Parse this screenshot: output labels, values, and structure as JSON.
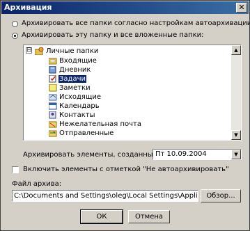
{
  "window": {
    "title": "Архивация",
    "close_glyph": "✕"
  },
  "options": {
    "radio_default": "Архивировать все папки согласно настройкам автоархивации",
    "radio_custom": "Архивировать эту папку и все вложенные папки:",
    "selected": "custom"
  },
  "tree": {
    "root": {
      "label": "Личные папки",
      "expander": "⊟",
      "icon": "personal-folders-icon"
    },
    "items": [
      {
        "label": "Входящие",
        "icon": "inbox-icon",
        "selected": false
      },
      {
        "label": "Дневник",
        "icon": "journal-icon",
        "selected": false
      },
      {
        "label": "Задачи",
        "icon": "tasks-icon",
        "selected": true
      },
      {
        "label": "Заметки",
        "icon": "notes-icon",
        "selected": false
      },
      {
        "label": "Исходящие",
        "icon": "outbox-icon",
        "selected": false
      },
      {
        "label": "Календарь",
        "icon": "calendar-icon",
        "selected": false
      },
      {
        "label": "Контакты",
        "icon": "contacts-icon",
        "selected": false
      },
      {
        "label": "Нежелательная почта",
        "icon": "junk-mail-icon",
        "selected": false
      },
      {
        "label": "Отправленные",
        "icon": "sent-items-icon",
        "selected": false
      }
    ]
  },
  "archive_older": {
    "label": "Архивировать элементы, созданные до:",
    "value": "Пт 10.09.2004"
  },
  "include_checkbox": {
    "label": "Включить элементы с отметкой \"Не автоархивировать\"",
    "checked": false
  },
  "archive_file": {
    "label": "Файл архива:",
    "value": "C:\\Documents and Settings\\oleg\\Local Settings\\Application Da",
    "browse": "Обзор..."
  },
  "buttons": {
    "ok": "ОК",
    "cancel": "Отмена"
  },
  "colors": {
    "titlebar_start": "#0a246a",
    "titlebar_end": "#3a6ea5",
    "dialog_bg": "#d4d0c8",
    "selection": "#0a246a"
  }
}
